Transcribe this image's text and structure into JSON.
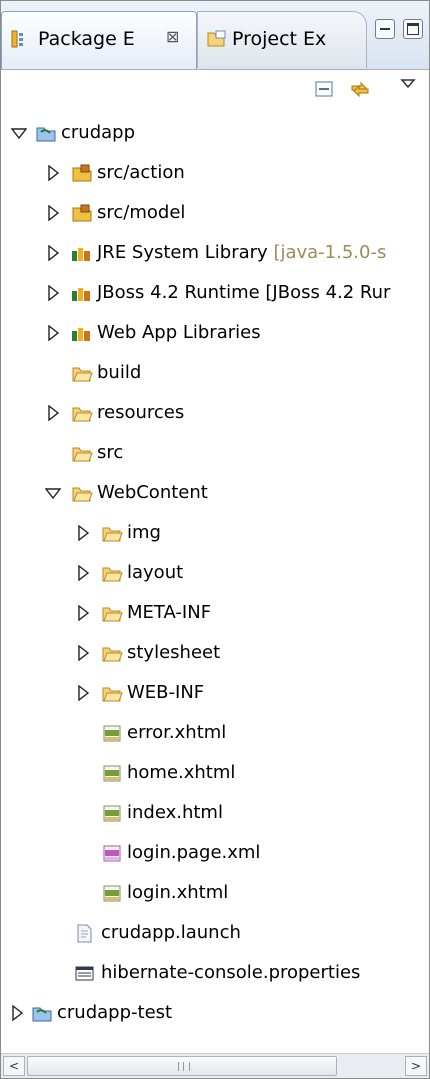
{
  "tabs": [
    {
      "label": "Package E",
      "icon": "package-explorer-icon",
      "close": "⊠",
      "active": true
    },
    {
      "label": "Project Ex",
      "icon": "project-explorer-icon",
      "active": false
    }
  ],
  "window_controls": {
    "minimize": "minimize-icon",
    "maximize": "maximize-icon"
  },
  "toolbar": {
    "collapse_all": "collapse-all-icon",
    "link_editor": "link-with-editor-icon",
    "view_menu": "view-menu-icon"
  },
  "tree": {
    "items": [
      {
        "label": "crudapp",
        "icon": "java-project-icon",
        "expanded": true
      },
      {
        "label": "src/action",
        "icon": "source-folder-icon",
        "expanded": false
      },
      {
        "label": "src/model",
        "icon": "source-folder-icon",
        "expanded": false
      },
      {
        "label": "JRE System Library",
        "decoration": "[java-1.5.0-s",
        "icon": "library-icon",
        "expanded": false
      },
      {
        "label": "JBoss 4.2 Runtime [JBoss 4.2 Rur",
        "icon": "library-icon",
        "expanded": false
      },
      {
        "label": "Web App Libraries",
        "icon": "library-icon",
        "expanded": false
      },
      {
        "label": "build",
        "icon": "folder-icon"
      },
      {
        "label": "resources",
        "icon": "folder-icon",
        "expanded": false
      },
      {
        "label": "src",
        "icon": "folder-icon"
      },
      {
        "label": "WebContent",
        "icon": "folder-icon",
        "expanded": true
      },
      {
        "label": "img",
        "icon": "folder-icon",
        "expanded": false
      },
      {
        "label": "layout",
        "icon": "folder-icon",
        "expanded": false
      },
      {
        "label": "META-INF",
        "icon": "folder-icon",
        "expanded": false
      },
      {
        "label": "stylesheet",
        "icon": "folder-icon",
        "expanded": false
      },
      {
        "label": "WEB-INF",
        "icon": "folder-icon",
        "expanded": false
      },
      {
        "label": "error.xhtml",
        "icon": "html-file-icon"
      },
      {
        "label": "home.xhtml",
        "icon": "html-file-icon"
      },
      {
        "label": "index.html",
        "icon": "html-file-icon"
      },
      {
        "label": "login.page.xml",
        "icon": "xml-file-icon"
      },
      {
        "label": "login.xhtml",
        "icon": "html-file-icon"
      },
      {
        "label": "crudapp.launch",
        "icon": "launch-file-icon"
      },
      {
        "label": "hibernate-console.properties",
        "icon": "properties-file-icon"
      },
      {
        "label": "crudapp-test",
        "icon": "java-project-icon",
        "expanded": false
      }
    ]
  },
  "scrollbar": {
    "left_arrow": "<",
    "right_arrow": ">"
  },
  "colors": {
    "decoration_text": "#a08a5a",
    "tab_bar": "#d9e3f1",
    "folder": "#e8b84a",
    "library": "#2e7d32"
  }
}
